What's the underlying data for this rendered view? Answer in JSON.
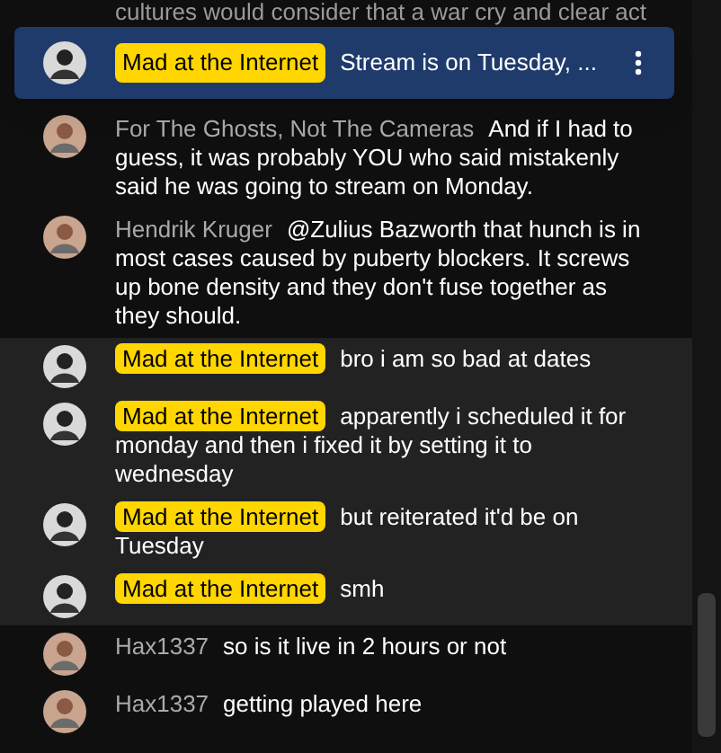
{
  "cut_message": {
    "text": "cultures would consider that a war cry and clear act"
  },
  "pinned": {
    "author": "Mad at the Internet",
    "text": "Stream is on Tuesday, ..."
  },
  "messages": [
    {
      "author": "For The Ghosts, Not The Cameras",
      "text": "And if I had to guess, it was probably YOU who said mistakenly said he was going to stream on Monday.",
      "owner": false
    },
    {
      "author": "Hendrik Kruger",
      "text": "@Zulius Bazworth that hunch is in most cases caused by puberty blockers. It screws up bone density and they don't fuse together as they should.",
      "owner": false
    },
    {
      "author": "Mad at the Internet",
      "text": "bro i am so bad at dates",
      "owner": true
    },
    {
      "author": "Mad at the Internet",
      "text": "apparently i scheduled it for monday and then i fixed it by setting it to wednesday",
      "owner": true
    },
    {
      "author": "Mad at the Internet",
      "text": "but reiterated it'd be on Tuesday",
      "owner": true
    },
    {
      "author": "Mad at the Internet",
      "text": "smh",
      "owner": true
    },
    {
      "author": "Hax1337",
      "text": "so is it live in 2 hours or not",
      "owner": false
    },
    {
      "author": "Hax1337",
      "text": "getting played here",
      "owner": false
    }
  ]
}
